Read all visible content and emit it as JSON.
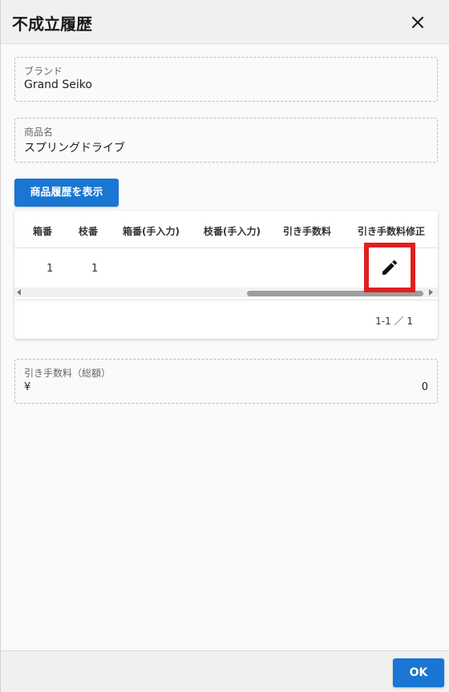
{
  "dialog": {
    "title": "不成立履歴",
    "close_icon": "close-icon"
  },
  "brand": {
    "label": "ブランド",
    "value": "Grand Seiko"
  },
  "product": {
    "label": "商品名",
    "value": "スプリングドライブ"
  },
  "history_button": {
    "label": "商品履歴を表示"
  },
  "table": {
    "columns": [
      "箱番",
      "枝番",
      "箱番(手入力)",
      "枝番(手入力)",
      "引き手数料",
      "引き手数料修正"
    ],
    "rows": [
      {
        "box_no": "1",
        "branch_no": "1",
        "box_manual": "",
        "branch_manual": "",
        "fee": "",
        "edit_icon": "pencil-icon"
      }
    ],
    "pagination": "1-1 ／ 1"
  },
  "total_fee": {
    "label": "引き手数料（総額）",
    "currency": "¥",
    "value": "0"
  },
  "footer": {
    "ok_label": "OK"
  },
  "colors": {
    "primary": "#1976d2",
    "highlight": "#e02020"
  }
}
